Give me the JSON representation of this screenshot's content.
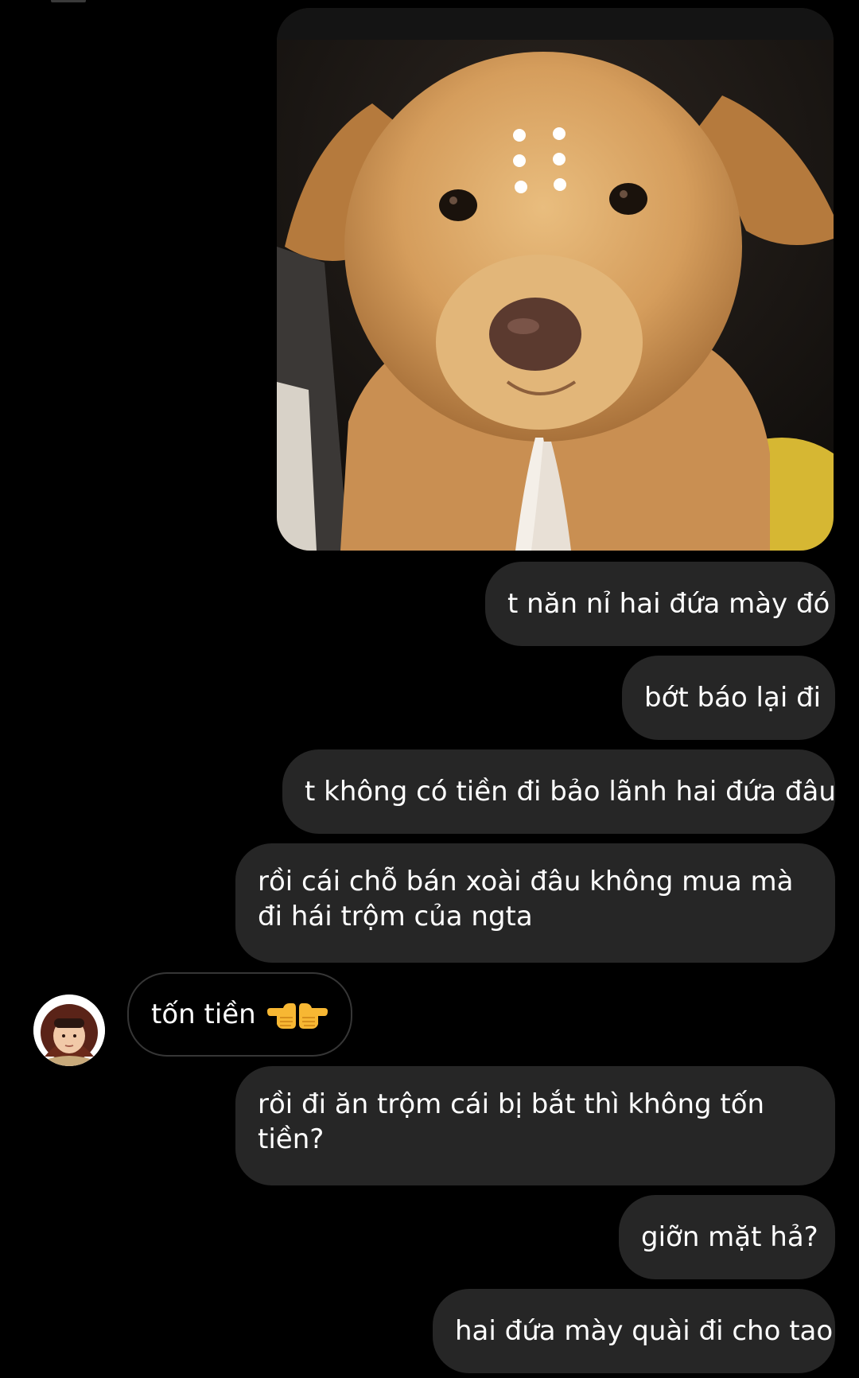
{
  "conversation": {
    "shared_image": {
      "alt": "dog-praying-meme"
    },
    "messages": [
      {
        "id": "m1",
        "direction": "outgoing",
        "text": "t năn nỉ hai đứa mày đó"
      },
      {
        "id": "m2",
        "direction": "outgoing",
        "text": "bớt báo lại đi"
      },
      {
        "id": "m3",
        "direction": "outgoing",
        "text": "t không có tiền đi bảo lãnh hai đứa đâu"
      },
      {
        "id": "m4",
        "direction": "outgoing",
        "text": "rồi cái chỗ bán xoài đâu không mua mà đi hái trộm của ngta"
      },
      {
        "id": "m5",
        "direction": "incoming",
        "text": "tốn tiền",
        "emoji": [
          "backhand-index-pointing-left",
          "backhand-index-pointing-right"
        ]
      },
      {
        "id": "m6",
        "direction": "outgoing",
        "text": "rồi đi ăn trộm cái bị bắt thì không tốn tiền?"
      },
      {
        "id": "m7",
        "direction": "outgoing",
        "text": "giỡn mặt hả?"
      },
      {
        "id": "m8",
        "direction": "outgoing",
        "text": "hai đứa mày quài đi cho tao"
      }
    ]
  },
  "colors": {
    "background": "#000000",
    "outgoing_bubble": "#262626",
    "incoming_border": "#363636",
    "text": "#ffffff"
  }
}
